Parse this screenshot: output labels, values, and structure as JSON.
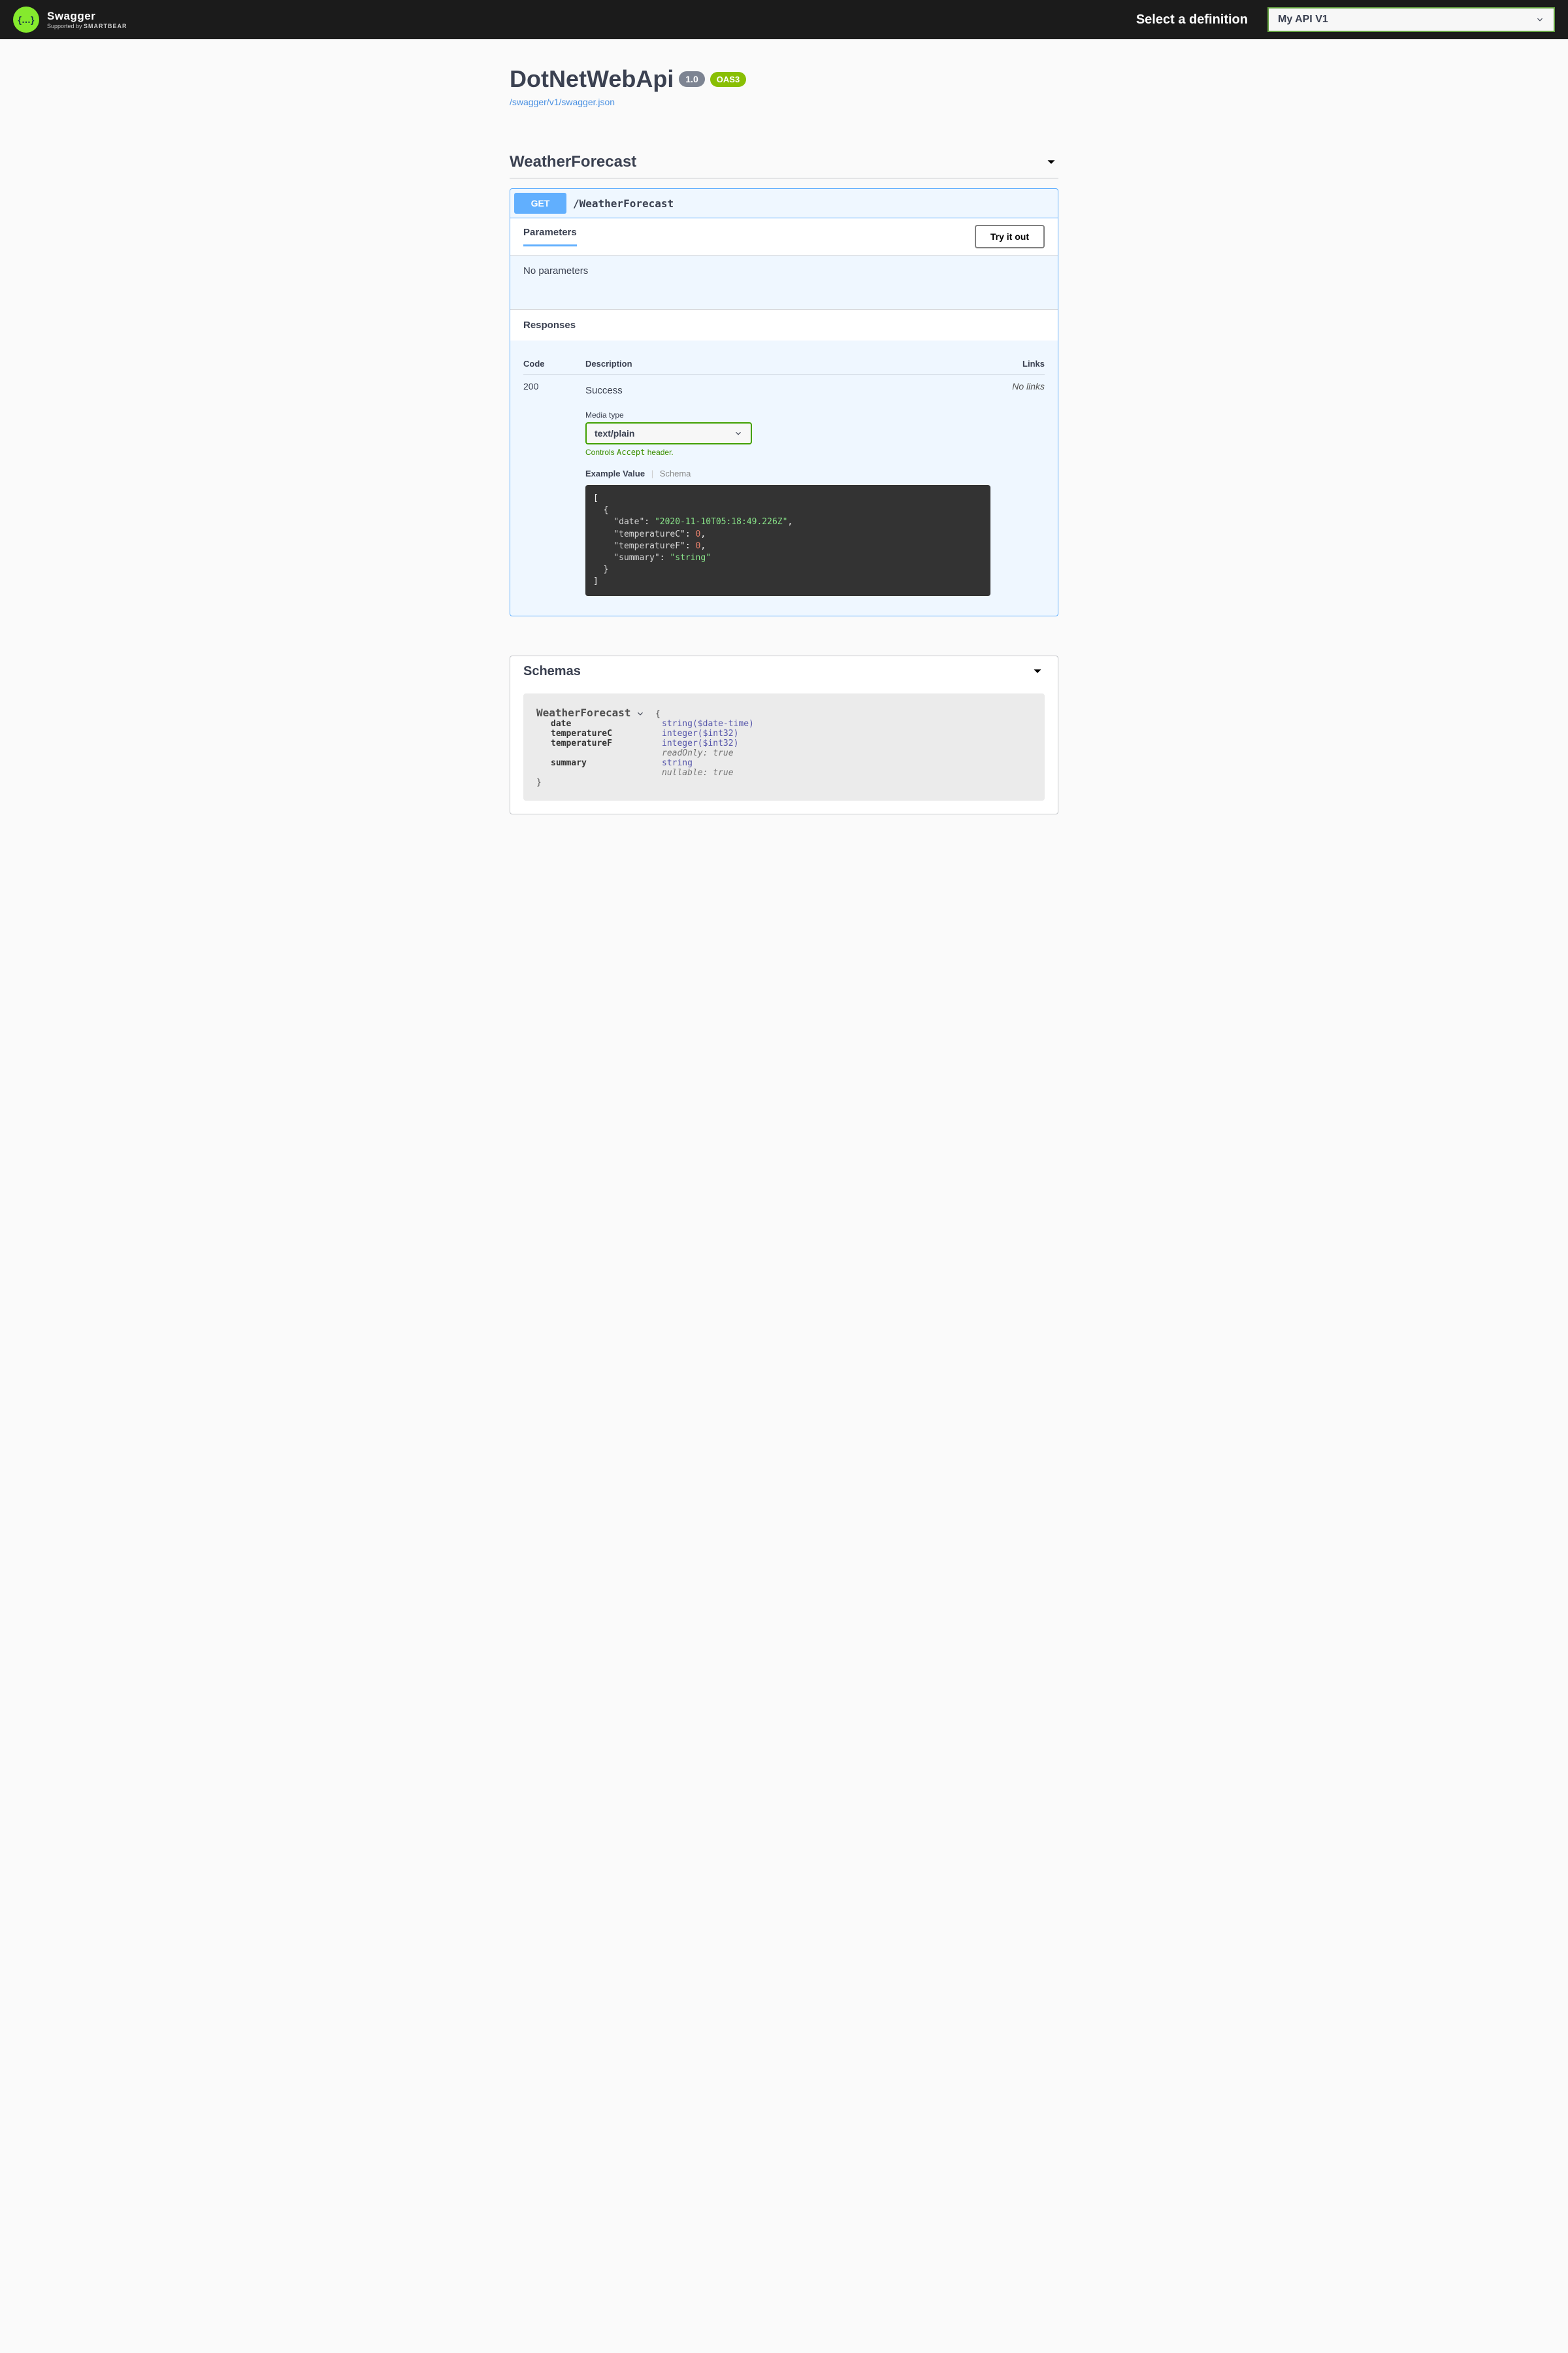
{
  "topbar": {
    "logo_title": "Swagger",
    "logo_sub_prefix": "Supported by ",
    "logo_sub_brand": "SMARTBEAR",
    "select_label": "Select a definition",
    "definition": "My API V1"
  },
  "info": {
    "title": "DotNetWebApi",
    "version": "1.0",
    "oas": "OAS3",
    "spec_url": "/swagger/v1/swagger.json"
  },
  "tag": {
    "name": "WeatherForecast"
  },
  "operation": {
    "method": "GET",
    "path": "/WeatherForecast",
    "params_header": "Parameters",
    "try_it": "Try it out",
    "no_params": "No parameters",
    "responses_header": "Responses",
    "cols": {
      "code": "Code",
      "desc": "Description",
      "links": "Links"
    },
    "response": {
      "code": "200",
      "desc": "Success",
      "links": "No links",
      "media_label": "Media type",
      "media_type": "text/plain",
      "media_hint_pre": "Controls ",
      "media_hint_code": "Accept",
      "media_hint_post": " header.",
      "tab_example": "Example Value",
      "tab_schema": "Schema",
      "example": {
        "date_key": "\"date\"",
        "date_val": "\"2020-11-10T05:18:49.226Z\"",
        "tc_key": "\"temperatureC\"",
        "tc_val": "0",
        "tf_key": "\"temperatureF\"",
        "tf_val": "0",
        "sum_key": "\"summary\"",
        "sum_val": "\"string\""
      }
    }
  },
  "schemas": {
    "header": "Schemas",
    "model": {
      "name": "WeatherForecast",
      "props": {
        "date": {
          "name": "date",
          "type": "string($date-time)"
        },
        "tc": {
          "name": "temperatureC",
          "type": "integer($int32)"
        },
        "tf": {
          "name": "temperatureF",
          "type": "integer($int32)",
          "note": "readOnly: true"
        },
        "sum": {
          "name": "summary",
          "type": "string",
          "note": "nullable: true"
        }
      }
    }
  }
}
